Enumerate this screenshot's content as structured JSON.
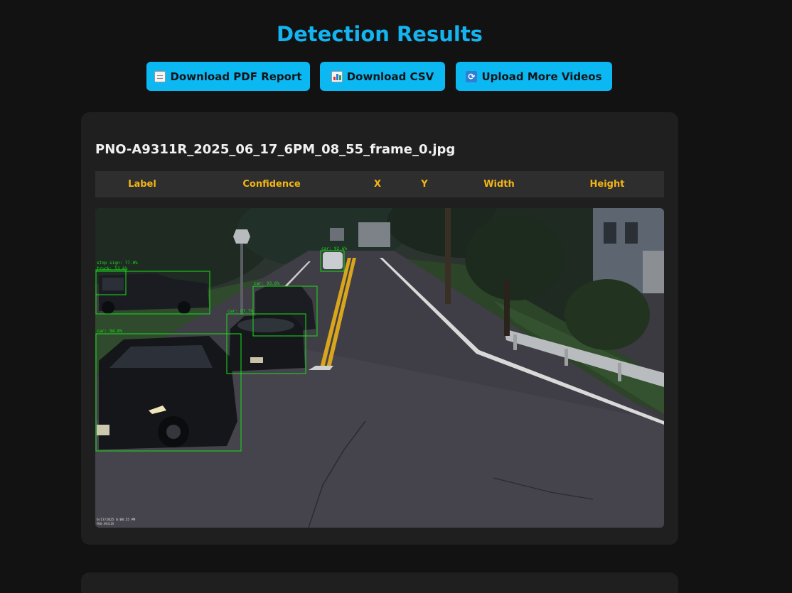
{
  "page": {
    "title": "Detection Results"
  },
  "actions": [
    {
      "label": "Download PDF Report",
      "icon": "document-icon"
    },
    {
      "label": "Download CSV",
      "icon": "bar-chart-icon"
    },
    {
      "label": "Upload More Videos",
      "icon": "refresh-icon"
    }
  ],
  "result": {
    "filename": "PNO-A9311R_2025_06_17_6PM_08_55_frame_0.jpg",
    "columns": [
      "Label",
      "Confidence",
      "X",
      "Y",
      "Width",
      "Height"
    ],
    "detections": [
      {
        "label": "stop sign: 77.0%"
      },
      {
        "label": "truck: 53.6%"
      },
      {
        "label": "car: 93.6%"
      },
      {
        "label": "car: 87.7%"
      },
      {
        "label": "car: 94.8%"
      },
      {
        "label": "car: 92.6%"
      }
    ],
    "timestamp_overlay": "6/17/2025 6:08:55 PM",
    "camera_overlay": "PNO-A9311R"
  },
  "colors": {
    "background": "#121212",
    "accent": "#13b4ef",
    "button": "#0cb8f2",
    "card": "#1f1f1f",
    "table_header": "#f3b516",
    "detection_box": "#18e018"
  }
}
